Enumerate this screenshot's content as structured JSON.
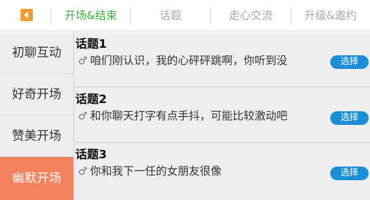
{
  "header": {
    "back_icon": "back-arrow-icon",
    "accent": "#f39b2e",
    "tabs": [
      {
        "label": "开场&结束",
        "active": true
      },
      {
        "label": "话题",
        "active": false
      },
      {
        "label": "走心交流",
        "active": false
      },
      {
        "label": "升级&邀约",
        "active": false
      }
    ]
  },
  "sidebar": {
    "active_color": "#f4835d",
    "items": [
      {
        "label": "初聊互动",
        "active": false
      },
      {
        "label": "好奇开场",
        "active": false
      },
      {
        "label": "赞美开场",
        "active": false
      },
      {
        "label": "幽默开场",
        "active": true
      }
    ]
  },
  "topics": {
    "item_icon": "male-symbol-icon",
    "button_color": "#1a8fd8",
    "items": [
      {
        "title": "话题1",
        "text": "咱们刚认识，我的心砰砰跳啊，你听到没",
        "button": "选择"
      },
      {
        "title": "话题2",
        "text": "和你聊天打字有点手抖，可能比较激动吧",
        "button": "选择"
      },
      {
        "title": "话题3",
        "text": "你和我下一任的女朋友很像",
        "button": "选择"
      }
    ]
  }
}
